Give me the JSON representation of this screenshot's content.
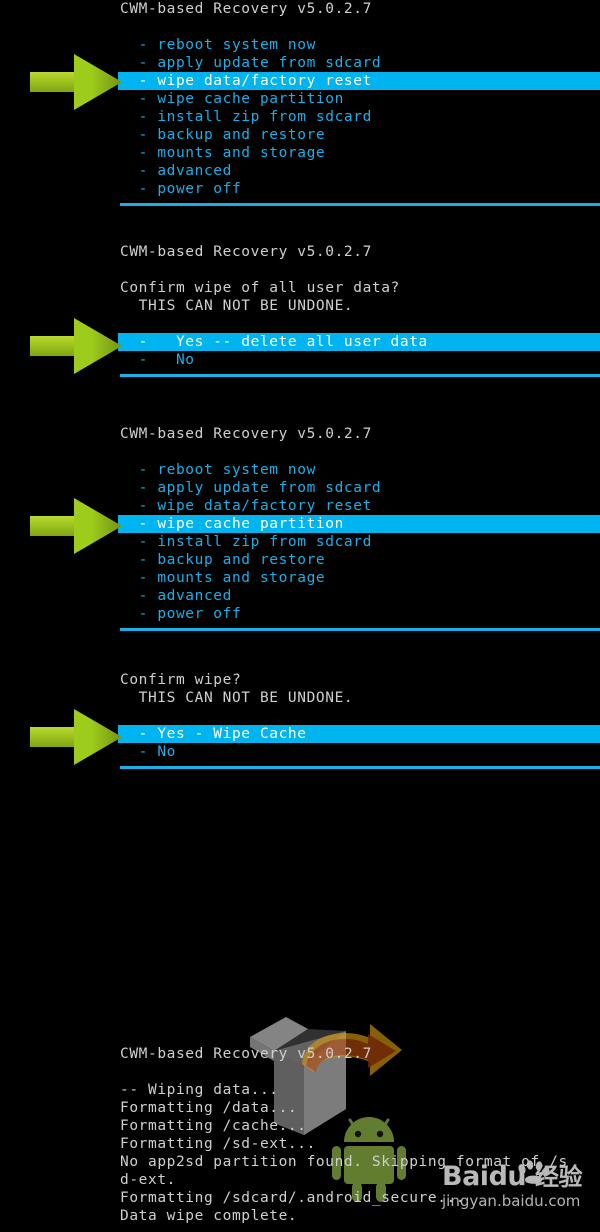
{
  "theme": {
    "background": "#000000",
    "menu_text": "#19afe8",
    "header_text": "#cfcfcf",
    "selection_background": "#00b4f0",
    "selection_text": "#ffffff",
    "rule": "#19afe8",
    "arrow": "#9ecc1c"
  },
  "panels": [
    {
      "id": "main-menu-wipe-data",
      "header": "CWM-based Recovery v5.0.2.7",
      "items": [
        {
          "label": "  - reboot system now",
          "selected": false
        },
        {
          "label": "  - apply update from sdcard",
          "selected": false
        },
        {
          "label": "  - wipe data/factory reset",
          "selected": true
        },
        {
          "label": "  - wipe cache partition",
          "selected": false
        },
        {
          "label": "  - install zip from sdcard",
          "selected": false
        },
        {
          "label": "  - backup and restore",
          "selected": false
        },
        {
          "label": "  - mounts and storage",
          "selected": false
        },
        {
          "label": "  - advanced",
          "selected": false
        },
        {
          "label": "  - power off",
          "selected": false
        }
      ]
    },
    {
      "id": "confirm-wipe-user-data",
      "header": "CWM-based Recovery v5.0.2.7",
      "prompt": [
        "Confirm wipe of all user data?",
        "  THIS CAN NOT BE UNDONE."
      ],
      "items": [
        {
          "label": "  -   Yes -- delete all user data",
          "selected": true
        },
        {
          "label": "  -   No",
          "selected": false
        }
      ]
    },
    {
      "id": "main-menu-wipe-cache",
      "header": "CWM-based Recovery v5.0.2.7",
      "items": [
        {
          "label": "  - reboot system now",
          "selected": false
        },
        {
          "label": "  - apply update from sdcard",
          "selected": false
        },
        {
          "label": "  - wipe data/factory reset",
          "selected": false
        },
        {
          "label": "  - wipe cache partition",
          "selected": true
        },
        {
          "label": "  - install zip from sdcard",
          "selected": false
        },
        {
          "label": "  - backup and restore",
          "selected": false
        },
        {
          "label": "  - mounts and storage",
          "selected": false
        },
        {
          "label": "  - advanced",
          "selected": false
        },
        {
          "label": "  - power off",
          "selected": false
        }
      ]
    },
    {
      "id": "confirm-wipe-cache",
      "prompt": [
        "Confirm wipe?",
        "  THIS CAN NOT BE UNDONE."
      ],
      "items": [
        {
          "label": "  - Yes - Wipe Cache",
          "selected": true
        },
        {
          "label": "  - No",
          "selected": false
        }
      ]
    },
    {
      "id": "wipe-log",
      "header": "CWM-based Recovery v5.0.2.7",
      "log": [
        "-- Wiping data...",
        "Formatting /data...",
        "Formatting /cache...",
        "Formatting /sd-ext...",
        "No app2sd partition found. Skipping format of /s",
        "d-ext.",
        "Formatting /sdcard/.android_secure...",
        "Data wipe complete."
      ]
    }
  ],
  "pointers": [
    {
      "id": "pointer-wipe-data-factory-reset",
      "target": "wipe data/factory reset"
    },
    {
      "id": "pointer-yes-delete-all-user-data",
      "target": "Yes -- delete all user data"
    },
    {
      "id": "pointer-wipe-cache-partition",
      "target": "wipe cache partition"
    },
    {
      "id": "pointer-yes-wipe-cache",
      "target": "Yes - Wipe Cache"
    }
  ],
  "watermark": {
    "brand": "Bai",
    "brand_du": "du",
    "brand_cn": "经验",
    "url": "jingyan.baidu.com"
  },
  "artwork": {
    "box": "recovery-box-icon",
    "arrow": "orange-curved-arrow-icon",
    "droid": "android-robot-icon"
  }
}
